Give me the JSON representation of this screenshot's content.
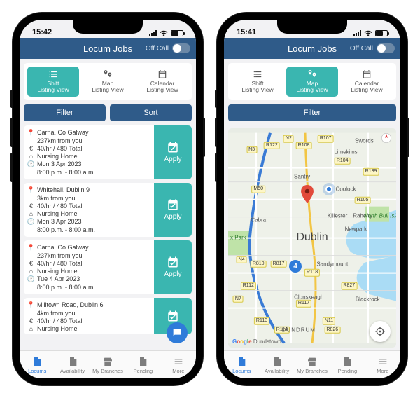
{
  "status": {
    "time_left": "15:42",
    "time_right": "15:41"
  },
  "header": {
    "title": "Locum Jobs",
    "off_call_label": "Off Call"
  },
  "view_tabs": {
    "shift": "Shift\nListing View",
    "map": "Map\nListing View",
    "calendar": "Calendar\nListing View"
  },
  "actions": {
    "filter": "Filter",
    "sort": "Sort",
    "apply": "Apply"
  },
  "jobs": [
    {
      "location": "Carna. Co Galway",
      "distance": "237km from you",
      "pay": "40/hr / 480 Total",
      "facility": "Nursing Home",
      "date": "Mon 3 Apr 2023",
      "time": "8:00 p.m. - 8:00 a.m."
    },
    {
      "location": "Whitehall, Dublin 9",
      "distance": "3km from you",
      "pay": "40/hr / 480 Total",
      "facility": "Nursing Home",
      "date": "Mon 3 Apr 2023",
      "time": "8:00 p.m. - 8:00 a.m."
    },
    {
      "location": "Carna. Co Galway",
      "distance": "237km from you",
      "pay": "40/hr / 480 Total",
      "facility": "Nursing Home",
      "date": "Tue 4 Apr 2023",
      "time": "8:00 p.m. - 8:00 a.m."
    },
    {
      "location": "Milltown Road, Dublin 6",
      "distance": "4km from you",
      "pay": "40/hr / 480 Total",
      "facility": "Nursing Home",
      "date": "",
      "time": ""
    }
  ],
  "tabs": {
    "locums": "Locums",
    "availability": "Availability",
    "branches": "My Branches",
    "pending": "Pending",
    "more": "More"
  },
  "map": {
    "city": "Dublin",
    "cluster_count": "4",
    "credit": "Google",
    "credit_sub": "Dundstown",
    "roads": [
      "M50",
      "N2",
      "N3",
      "N4",
      "N7",
      "N11",
      "R107",
      "R108",
      "R122",
      "R104",
      "R139",
      "R105",
      "R817",
      "R810",
      "R118",
      "R113",
      "R114",
      "R117",
      "R827",
      "R826",
      "R112"
    ],
    "places": [
      "Swords",
      "Limekilns",
      "Santry",
      "Coolock",
      "Raheny",
      "Killester",
      "Cabra",
      "Sandymount",
      "Clonskeagh",
      "Blackrock",
      "DUNDRUM",
      "Newpark",
      "North Bull Island",
      "x Park"
    ]
  }
}
